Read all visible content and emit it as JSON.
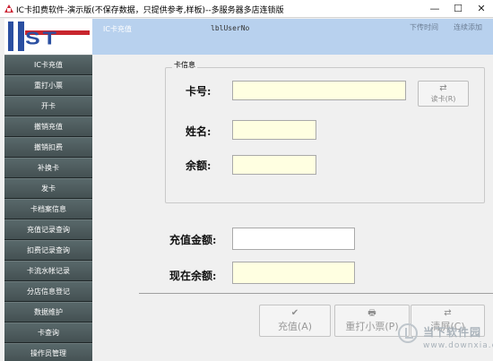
{
  "window": {
    "title": "IC卡扣费软件-演示版(不保存数据，只提供参考,样板)--多服务器多店连锁版",
    "min": "—",
    "max": "☐",
    "close": "✕"
  },
  "logo": {
    "text": "ST"
  },
  "header": {
    "section": "IC卡充值",
    "user": "lblUserNo",
    "link_upload": "下传时间",
    "link_connect": "连续添加"
  },
  "sidebar": {
    "items": [
      "IC卡充值",
      "重打小票",
      "开卡",
      "撤销充值",
      "撤销扣费",
      "补换卡",
      "发卡",
      "卡档案信息",
      "充值记录查询",
      "扣费记录查询",
      "卡流水帐记录",
      "分店信息登记",
      "数据维护",
      "卡查询",
      "操作员管理"
    ]
  },
  "card_info": {
    "group_title": "卡信息",
    "card_no_label": "卡号:",
    "card_no_value": "",
    "name_label": "姓名:",
    "name_value": "",
    "balance_label": "余额:",
    "balance_value": "",
    "read_button": "读卡(R)",
    "read_icon": "⇄"
  },
  "recharge": {
    "amount_label": "充值金额:",
    "amount_value": "",
    "current_label": "现在余额:",
    "current_value": ""
  },
  "actions": {
    "recharge_btn": "充值(A)",
    "recharge_icon": "✔",
    "reprint_btn": "重打小票(P)",
    "reprint_icon": "🖶",
    "clear_btn": "清屏(C)",
    "clear_icon": "⇄"
  },
  "watermark": {
    "line1": "当下软件园",
    "line2": "www.downxia.com"
  }
}
